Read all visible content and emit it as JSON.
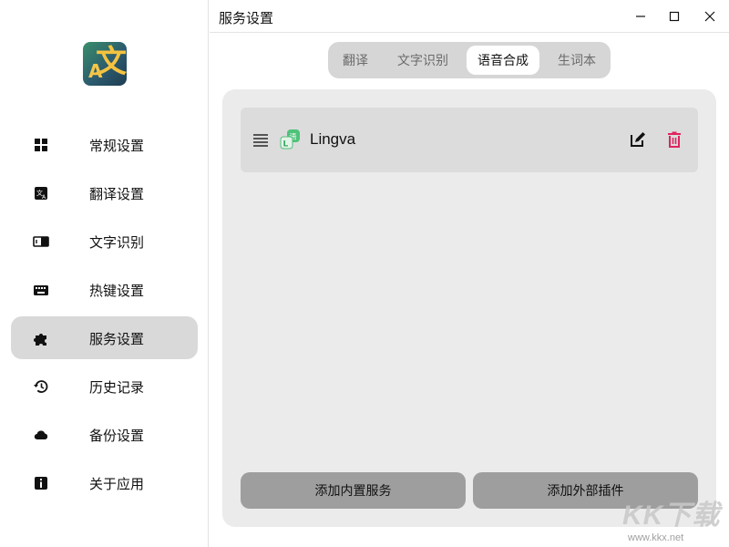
{
  "window": {
    "title": "服务设置"
  },
  "sidebar": {
    "items": [
      {
        "label": "常规设置",
        "icon": "grid-icon",
        "active": false
      },
      {
        "label": "翻译设置",
        "icon": "translate-icon",
        "active": false
      },
      {
        "label": "文字识别",
        "icon": "ocr-icon",
        "active": false
      },
      {
        "label": "热键设置",
        "icon": "keyboard-icon",
        "active": false
      },
      {
        "label": "服务设置",
        "icon": "puzzle-icon",
        "active": true
      },
      {
        "label": "历史记录",
        "icon": "history-icon",
        "active": false
      },
      {
        "label": "备份设置",
        "icon": "cloud-icon",
        "active": false
      },
      {
        "label": "关于应用",
        "icon": "info-icon",
        "active": false
      }
    ]
  },
  "tabs": [
    {
      "label": "翻译",
      "active": false
    },
    {
      "label": "文字识别",
      "active": false
    },
    {
      "label": "语音合成",
      "active": true
    },
    {
      "label": "生词本",
      "active": false
    }
  ],
  "services": [
    {
      "name": "Lingva",
      "icon": "lingva-icon"
    }
  ],
  "buttons": {
    "add_builtin": "添加内置服务",
    "add_plugin": "添加外部插件"
  },
  "watermark": {
    "logo": "KK下载",
    "url": "www.kkx.net"
  },
  "colors": {
    "active_nav_bg": "#d9d9d9",
    "panel_bg": "#ebebeb",
    "delete_icon": "#e0245e",
    "button_bg": "#9e9e9e"
  }
}
